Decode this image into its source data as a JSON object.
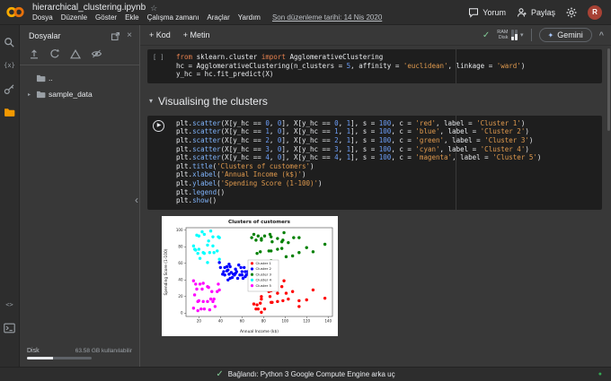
{
  "header": {
    "title": "hierarchical_clustering.ipynb",
    "menus": [
      "Dosya",
      "Düzenle",
      "Göster",
      "Ekle",
      "Çalışma zamanı",
      "Araçlar",
      "Yardım"
    ],
    "last_edited": "Son düzenleme tarihi: 14 Nis 2020",
    "comment_label": "Yorum",
    "share_label": "Paylaş",
    "avatar_initial": "R"
  },
  "toolbar": {
    "add_code_label": "+ Kod",
    "add_text_label": "+ Metin",
    "ram_label": "RAM",
    "disk_label": "Disk",
    "gemini_label": "Gemini"
  },
  "sidebar": {
    "panel_title": "Dosyalar",
    "tree_items": [
      {
        "label": ".."
      },
      {
        "label": "sample_data"
      }
    ],
    "disk_label": "Disk",
    "disk_available": "63.58 GB kullanılabilir",
    "disk_used_pct": 40
  },
  "icons": {
    "star": "☆",
    "check": "✓",
    "chevron_down": "▾",
    "chevron_right": "▸",
    "chevron_up": "^",
    "close": "×",
    "dot": "●",
    "variables": "{x}",
    "code_snippets": "<>",
    "play": "▶",
    "collapse_left": "‹",
    "dropdown": "▾"
  },
  "notebook": {
    "cell1": {
      "gutter": "[ ]",
      "lines": [
        [
          [
            "from ",
            "k"
          ],
          [
            "sklearn.cluster ",
            "p"
          ],
          [
            "import ",
            "k"
          ],
          [
            "AgglomerativeClustering",
            "p"
          ]
        ],
        [
          [
            "hc = AgglomerativeClustering(n_clusters = ",
            "p"
          ],
          [
            "5",
            "n"
          ],
          [
            ", affinity = ",
            "p"
          ],
          [
            "'euclidean'",
            "s"
          ],
          [
            ", linkage = ",
            "p"
          ],
          [
            "'ward'",
            "s"
          ],
          [
            ")",
            "p"
          ]
        ],
        [
          [
            "y_hc = hc.fit_predict(X)",
            "p"
          ]
        ]
      ]
    },
    "section_heading": "Visualising the clusters",
    "cell2": {
      "lines": [
        [
          [
            "plt.",
            "p"
          ],
          [
            "scatter",
            "f"
          ],
          [
            "(X[y_hc == ",
            "p"
          ],
          [
            "0",
            "n"
          ],
          [
            ", ",
            "p"
          ],
          [
            "0",
            "n"
          ],
          [
            "], X[y_hc == ",
            "p"
          ],
          [
            "0",
            "n"
          ],
          [
            ", ",
            "p"
          ],
          [
            "1",
            "n"
          ],
          [
            "], s = ",
            "p"
          ],
          [
            "100",
            "n"
          ],
          [
            ", c = ",
            "p"
          ],
          [
            "'red'",
            "s"
          ],
          [
            ", label = ",
            "p"
          ],
          [
            "'Cluster 1'",
            "s"
          ],
          [
            ")",
            "p"
          ]
        ],
        [
          [
            "plt.",
            "p"
          ],
          [
            "scatter",
            "f"
          ],
          [
            "(X[y_hc == ",
            "p"
          ],
          [
            "1",
            "n"
          ],
          [
            ", ",
            "p"
          ],
          [
            "0",
            "n"
          ],
          [
            "], X[y_hc == ",
            "p"
          ],
          [
            "1",
            "n"
          ],
          [
            ", ",
            "p"
          ],
          [
            "1",
            "n"
          ],
          [
            "], s = ",
            "p"
          ],
          [
            "100",
            "n"
          ],
          [
            ", c = ",
            "p"
          ],
          [
            "'blue'",
            "s"
          ],
          [
            ", label = ",
            "p"
          ],
          [
            "'Cluster 2'",
            "s"
          ],
          [
            ")",
            "p"
          ]
        ],
        [
          [
            "plt.",
            "p"
          ],
          [
            "scatter",
            "f"
          ],
          [
            "(X[y_hc == ",
            "p"
          ],
          [
            "2",
            "n"
          ],
          [
            ", ",
            "p"
          ],
          [
            "0",
            "n"
          ],
          [
            "], X[y_hc == ",
            "p"
          ],
          [
            "2",
            "n"
          ],
          [
            ", ",
            "p"
          ],
          [
            "1",
            "n"
          ],
          [
            "], s = ",
            "p"
          ],
          [
            "100",
            "n"
          ],
          [
            ", c = ",
            "p"
          ],
          [
            "'green'",
            "s"
          ],
          [
            ", label = ",
            "p"
          ],
          [
            "'Cluster 3'",
            "s"
          ],
          [
            ")",
            "p"
          ]
        ],
        [
          [
            "plt.",
            "p"
          ],
          [
            "scatter",
            "f"
          ],
          [
            "(X[y_hc == ",
            "p"
          ],
          [
            "3",
            "n"
          ],
          [
            ", ",
            "p"
          ],
          [
            "0",
            "n"
          ],
          [
            "], X[y_hc == ",
            "p"
          ],
          [
            "3",
            "n"
          ],
          [
            ", ",
            "p"
          ],
          [
            "1",
            "n"
          ],
          [
            "], s = ",
            "p"
          ],
          [
            "100",
            "n"
          ],
          [
            ", c = ",
            "p"
          ],
          [
            "'cyan'",
            "s"
          ],
          [
            ", label = ",
            "p"
          ],
          [
            "'Cluster 4'",
            "s"
          ],
          [
            ")",
            "p"
          ]
        ],
        [
          [
            "plt.",
            "p"
          ],
          [
            "scatter",
            "f"
          ],
          [
            "(X[y_hc == ",
            "p"
          ],
          [
            "4",
            "n"
          ],
          [
            ", ",
            "p"
          ],
          [
            "0",
            "n"
          ],
          [
            "], X[y_hc == ",
            "p"
          ],
          [
            "4",
            "n"
          ],
          [
            ", ",
            "p"
          ],
          [
            "1",
            "n"
          ],
          [
            "], s = ",
            "p"
          ],
          [
            "100",
            "n"
          ],
          [
            ", c = ",
            "p"
          ],
          [
            "'magenta'",
            "s"
          ],
          [
            ", label = ",
            "p"
          ],
          [
            "'Cluster 5'",
            "s"
          ],
          [
            ")",
            "p"
          ]
        ],
        [
          [
            "plt.",
            "p"
          ],
          [
            "title",
            "f"
          ],
          [
            "(",
            "p"
          ],
          [
            "'Clusters of customers'",
            "s"
          ],
          [
            ")",
            "p"
          ]
        ],
        [
          [
            "plt.",
            "p"
          ],
          [
            "xlabel",
            "f"
          ],
          [
            "(",
            "p"
          ],
          [
            "'Annual Income (k$)'",
            "s"
          ],
          [
            ")",
            "p"
          ]
        ],
        [
          [
            "plt.",
            "p"
          ],
          [
            "ylabel",
            "f"
          ],
          [
            "(",
            "p"
          ],
          [
            "'Spending Score (1-100)'",
            "s"
          ],
          [
            ")",
            "p"
          ]
        ],
        [
          [
            "plt.",
            "p"
          ],
          [
            "legend",
            "f"
          ],
          [
            "()",
            "p"
          ]
        ],
        [
          [
            "plt.",
            "p"
          ],
          [
            "show",
            "f"
          ],
          [
            "()",
            "p"
          ]
        ]
      ]
    }
  },
  "statusbar": {
    "text": "Bağlandı: Python 3 Google Compute Engine arka uç"
  },
  "chart_data": {
    "type": "scatter",
    "title": "Clusters of customers",
    "xlabel": "Annual Income (k$)",
    "ylabel": "Spending Score (1-100)",
    "xlim": [
      8,
      144
    ],
    "ylim": [
      -4,
      103
    ],
    "xticks": [
      20,
      40,
      60,
      80,
      100,
      120,
      140
    ],
    "yticks": [
      0,
      20,
      40,
      60,
      80,
      100
    ],
    "grid": false,
    "legend_position": "center right",
    "series": [
      {
        "name": "Cluster 1",
        "color": "red",
        "points": [
          [
            70,
            29
          ],
          [
            71,
            11
          ],
          [
            73,
            5
          ],
          [
            74,
            10
          ],
          [
            75,
            5
          ],
          [
            77,
            12
          ],
          [
            78,
            17
          ],
          [
            78,
            20
          ],
          [
            81,
            5
          ],
          [
            85,
            26
          ],
          [
            86,
            20
          ],
          [
            87,
            27
          ],
          [
            87,
            13
          ],
          [
            88,
            13
          ],
          [
            93,
            14
          ],
          [
            97,
            32
          ],
          [
            98,
            15
          ],
          [
            99,
            39
          ],
          [
            101,
            24
          ],
          [
            103,
            17
          ],
          [
            107,
            26
          ],
          [
            113,
            8
          ],
          [
            120,
            16
          ],
          [
            126,
            28
          ],
          [
            137,
            18
          ],
          [
            78,
            1
          ],
          [
            93,
            24
          ],
          [
            113,
            15
          ]
        ]
      },
      {
        "name": "Cluster 2",
        "color": "blue",
        "points": [
          [
            39,
            61
          ],
          [
            40,
            55
          ],
          [
            42,
            47
          ],
          [
            43,
            50
          ],
          [
            44,
            46
          ],
          [
            46,
            51
          ],
          [
            46,
            56
          ],
          [
            47,
            40
          ],
          [
            48,
            47
          ],
          [
            48,
            59
          ],
          [
            49,
            42
          ],
          [
            50,
            49
          ],
          [
            51,
            43
          ],
          [
            52,
            47
          ],
          [
            54,
            53
          ],
          [
            54,
            48
          ],
          [
            56,
            42
          ],
          [
            57,
            58
          ],
          [
            58,
            46
          ],
          [
            59,
            55
          ],
          [
            60,
            50
          ],
          [
            60,
            46
          ],
          [
            61,
            42
          ],
          [
            62,
            55
          ],
          [
            63,
            50
          ],
          [
            64,
            46
          ],
          [
            65,
            50
          ],
          [
            66,
            48
          ],
          [
            67,
            52
          ],
          [
            68,
            48
          ],
          [
            69,
            58
          ],
          [
            70,
            55
          ],
          [
            71,
            47
          ],
          [
            72,
            47
          ],
          [
            73,
            53
          ],
          [
            74,
            52
          ],
          [
            75,
            59
          ],
          [
            76,
            42
          ],
          [
            44,
            55
          ],
          [
            47,
            52
          ],
          [
            55,
            50
          ],
          [
            63,
            44
          ],
          [
            67,
            43
          ],
          [
            71,
            51
          ],
          [
            49,
            56
          ],
          [
            53,
            46
          ]
        ]
      },
      {
        "name": "Cluster 3",
        "color": "green",
        "points": [
          [
            69,
            91
          ],
          [
            71,
            95
          ],
          [
            73,
            88
          ],
          [
            74,
            72
          ],
          [
            75,
            93
          ],
          [
            77,
            74
          ],
          [
            78,
            90
          ],
          [
            78,
            88
          ],
          [
            81,
            93
          ],
          [
            85,
            75
          ],
          [
            86,
            95
          ],
          [
            87,
            63
          ],
          [
            87,
            75
          ],
          [
            88,
            86
          ],
          [
            93,
            90
          ],
          [
            97,
            86
          ],
          [
            98,
            88
          ],
          [
            99,
            97
          ],
          [
            101,
            68
          ],
          [
            103,
            85
          ],
          [
            107,
            69
          ],
          [
            108,
            91
          ],
          [
            113,
            91
          ],
          [
            120,
            79
          ],
          [
            126,
            74
          ],
          [
            137,
            83
          ],
          [
            93,
            77
          ],
          [
            113,
            73
          ],
          [
            97,
            78
          ],
          [
            87,
            92
          ]
        ]
      },
      {
        "name": "Cluster 4",
        "color": "cyan",
        "points": [
          [
            15,
            81
          ],
          [
            16,
            77
          ],
          [
            17,
            76
          ],
          [
            18,
            94
          ],
          [
            19,
            72
          ],
          [
            20,
            77
          ],
          [
            21,
            66
          ],
          [
            23,
            98
          ],
          [
            24,
            73
          ],
          [
            25,
            72
          ],
          [
            28,
            82
          ],
          [
            28,
            61
          ],
          [
            29,
            87
          ],
          [
            30,
            73
          ],
          [
            33,
            92
          ],
          [
            33,
            81
          ],
          [
            34,
            73
          ],
          [
            37,
            75
          ],
          [
            38,
            92
          ],
          [
            39,
            91
          ],
          [
            39,
            65
          ],
          [
            25,
            95
          ],
          [
            20,
            93
          ],
          [
            31,
            99
          ]
        ]
      },
      {
        "name": "Cluster 5",
        "color": "magenta",
        "points": [
          [
            15,
            39
          ],
          [
            15,
            6
          ],
          [
            16,
            22
          ],
          [
            17,
            35
          ],
          [
            18,
            29
          ],
          [
            19,
            14
          ],
          [
            19,
            3
          ],
          [
            20,
            15
          ],
          [
            21,
            35
          ],
          [
            22,
            5
          ],
          [
            23,
            29
          ],
          [
            24,
            14
          ],
          [
            25,
            5
          ],
          [
            28,
            32
          ],
          [
            28,
            14
          ],
          [
            29,
            31
          ],
          [
            30,
            4
          ],
          [
            31,
            17
          ],
          [
            32,
            26
          ],
          [
            33,
            14
          ],
          [
            34,
            17
          ],
          [
            37,
            26
          ],
          [
            38,
            35
          ],
          [
            39,
            28
          ],
          [
            24,
            36
          ],
          [
            35,
            8
          ]
        ]
      }
    ]
  }
}
